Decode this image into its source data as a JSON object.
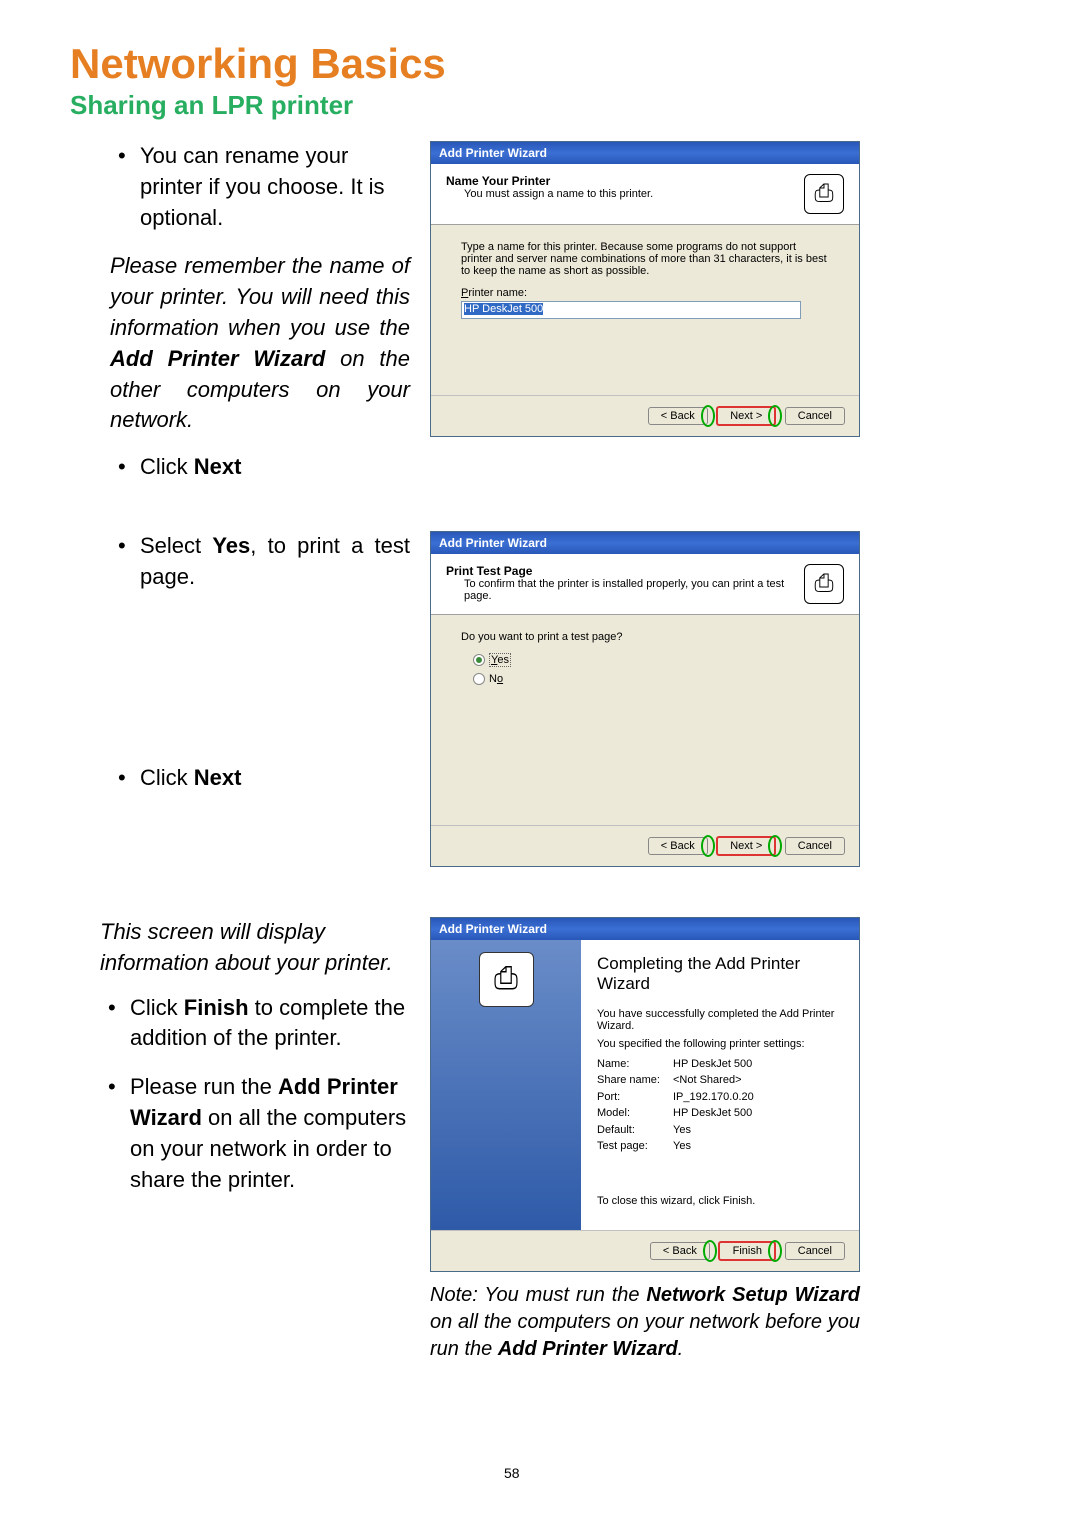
{
  "heading": {
    "main": "Networking Basics",
    "sub": "Sharing an LPR printer"
  },
  "section1": {
    "bullet1": "You can rename your printer if you choose.  It is optional.",
    "italic_prefix": "Please remember the name of your printer.  You will need this information when you use the ",
    "italic_bold": "Add Printer Wizard",
    "italic_suffix": " on the other computers on your network.",
    "bullet2_prefix": "Click ",
    "bullet2_bold": "Next"
  },
  "section2": {
    "bullet1_prefix": "Select ",
    "bullet1_bold": "Yes",
    "bullet1_suffix": ", to print a test page.",
    "bullet2_prefix": "Click ",
    "bullet2_bold": "Next"
  },
  "section3": {
    "intro": "This screen will display information about your printer.",
    "bullet1_prefix": "Click ",
    "bullet1_bold": "Finish",
    "bullet1_suffix": " to complete the addition of the printer.",
    "bullet2_prefix": "Please run the ",
    "bullet2_bold": "Add Printer Wizard",
    "bullet2_suffix": " on all the computers on your network in order to share the printer."
  },
  "wizard_title": "Add Printer Wizard",
  "w1": {
    "header_title": "Name Your Printer",
    "header_desc": "You must assign a name to this printer.",
    "instruction": "Type a name for this printer. Because some programs do not support printer and server name combinations of more than 31 characters, it is best to keep the name as short as possible.",
    "label_p": "P",
    "label_rest": "rinter name:",
    "input_value": "HP DeskJet 500"
  },
  "w2": {
    "header_title": "Print Test Page",
    "header_desc": "To confirm that the printer is installed properly, you can print a test page.",
    "question": "Do you want to print a test page?",
    "yes_y": "Y",
    "yes_es": "es",
    "no_n": "N",
    "no_o": "o"
  },
  "w3": {
    "heading": "Completing the Add Printer Wizard",
    "text1": "You have successfully completed the Add Printer Wizard.",
    "text2": "You specified the following printer settings:",
    "settings": {
      "name_l": "Name:",
      "name_v": "HP DeskJet 500",
      "share_l": "Share name:",
      "share_v": "<Not Shared>",
      "port_l": "Port:",
      "port_v": "IP_192.170.0.20",
      "model_l": "Model:",
      "model_v": "HP DeskJet 500",
      "default_l": "Default:",
      "default_v": "Yes",
      "test_l": "Test page:",
      "test_v": "Yes"
    },
    "close_text": "To close this wizard, click Finish."
  },
  "buttons": {
    "back": "< Back",
    "next": "Next >",
    "finish": "Finish",
    "cancel": "Cancel"
  },
  "note": {
    "prefix": "Note:  You must run the ",
    "bold1": "Network Setup Wizard",
    "mid": " on all the computers on your network before you run the ",
    "bold2": "Add Printer Wizard",
    "suffix": "."
  },
  "page_number": "58"
}
